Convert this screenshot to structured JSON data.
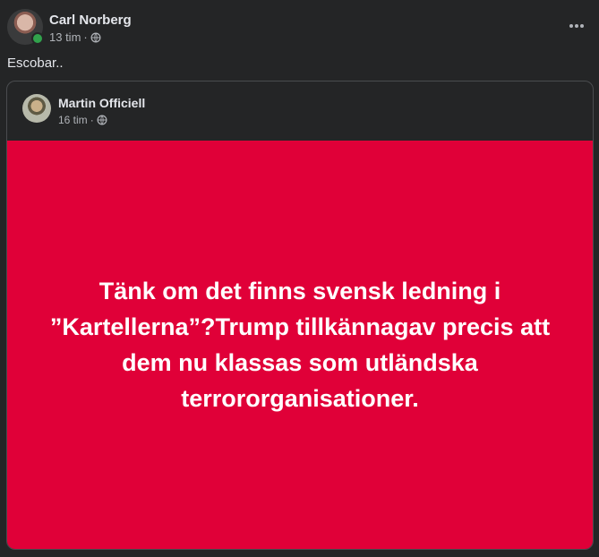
{
  "post": {
    "author": "Carl Norberg",
    "time": "13 tim",
    "caption": "Escobar.."
  },
  "shared_post": {
    "author": "Martin Officiell",
    "time": "16 tim",
    "text": "Tänk om det finns svensk ledning i ”Kartellerna”?Trump tillkännagav precis att dem nu klassas som utländska terrororganisationer.",
    "background_color": "#e00038"
  },
  "icons": {
    "more": "more-options-icon",
    "audience": "globe-icon",
    "presence": "online-status-icon"
  },
  "colors": {
    "background": "#242526",
    "text_primary": "#e4e6eb",
    "text_secondary": "#b0b3b8",
    "online": "#31a24c"
  }
}
